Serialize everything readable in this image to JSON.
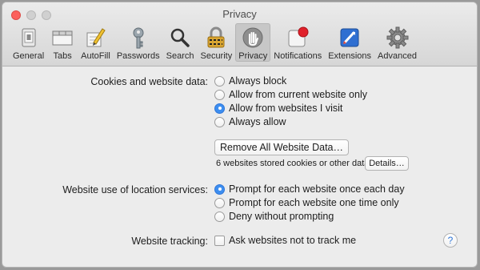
{
  "window": {
    "title": "Privacy"
  },
  "toolbar": {
    "items": [
      {
        "label": "General",
        "icon": "general-icon"
      },
      {
        "label": "Tabs",
        "icon": "tabs-icon"
      },
      {
        "label": "AutoFill",
        "icon": "autofill-icon"
      },
      {
        "label": "Passwords",
        "icon": "key-icon"
      },
      {
        "label": "Search",
        "icon": "magnifier-icon"
      },
      {
        "label": "Security",
        "icon": "lock-icon"
      },
      {
        "label": "Privacy",
        "icon": "hand-icon",
        "selected": true
      },
      {
        "label": "Notifications",
        "icon": "notification-icon"
      },
      {
        "label": "Extensions",
        "icon": "puzzle-icon"
      },
      {
        "label": "Advanced",
        "icon": "gear-icon"
      }
    ]
  },
  "cookies": {
    "label": "Cookies and website data:",
    "options": [
      {
        "label": "Always block",
        "selected": false
      },
      {
        "label": "Allow from current website only",
        "selected": false
      },
      {
        "label": "Allow from websites I visit",
        "selected": true
      },
      {
        "label": "Always allow",
        "selected": false
      }
    ],
    "remove_button": "Remove All Website Data…",
    "stored_text": "6 websites stored cookies or other data",
    "details_button": "Details…"
  },
  "location": {
    "label": "Website use of location services:",
    "options": [
      {
        "label": "Prompt for each website once each day",
        "selected": true
      },
      {
        "label": "Prompt for each website one time only",
        "selected": false
      },
      {
        "label": "Deny without prompting",
        "selected": false
      }
    ]
  },
  "tracking": {
    "label": "Website tracking:",
    "checkbox_label": "Ask websites not to track me",
    "checked": false
  },
  "help": {
    "glyph": "?"
  },
  "colors": {
    "accent": "#3d8ef0",
    "close_button": "#fc605c",
    "notification_badge": "#e0202a"
  }
}
